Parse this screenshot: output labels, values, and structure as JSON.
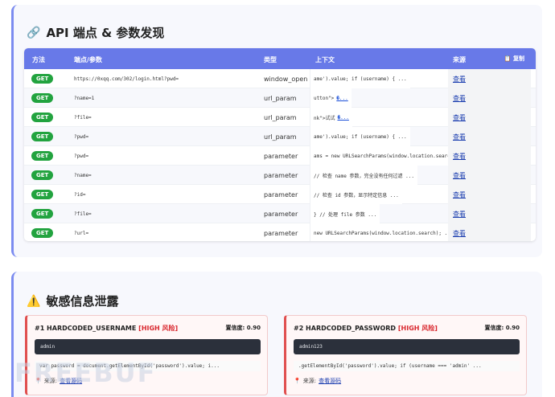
{
  "api_section": {
    "icon": "link-icon",
    "title": "API 端点 & 参数发现",
    "table": {
      "headers": {
        "method": "方法",
        "endpoint": "端点/参数",
        "type": "类型",
        "context": "上下文",
        "source": "来源"
      },
      "copy_label": "复制",
      "rows": [
        {
          "method": "GET",
          "endpoint": "https://0xqq.com/302/login.html?pwd=",
          "type": "window_open",
          "context": "ame').value; if (username) { ...",
          "context_link": "",
          "source": "查看"
        },
        {
          "method": "GET",
          "endpoint": "?name=1",
          "type": "url_param",
          "context": "utton\">",
          "context_link": "�...",
          "source": "查看"
        },
        {
          "method": "GET",
          "endpoint": "?file=",
          "type": "url_param",
          "context": "nk\">试试",
          "context_link": "�...",
          "source": "查看"
        },
        {
          "method": "GET",
          "endpoint": "?pwd=",
          "type": "url_param",
          "context": "ame').value; if (username) { ...",
          "context_link": "",
          "source": "查看"
        },
        {
          "method": "GET",
          "endpoint": "?pwd=",
          "type": "parameter",
          "context": "ams = new URLSearchParams(window.location.search); ...",
          "context_link": "",
          "source": "查看"
        },
        {
          "method": "GET",
          "endpoint": "?name=",
          "type": "parameter",
          "context": "// 检查 name 参数，完全没有任何过滤 ...",
          "context_link": "",
          "source": "查看"
        },
        {
          "method": "GET",
          "endpoint": "?id=",
          "type": "parameter",
          "context": "// 检查 id 参数，显示特定信息 ...",
          "context_link": "",
          "source": "查看"
        },
        {
          "method": "GET",
          "endpoint": "?file=",
          "type": "parameter",
          "context": "} // 处理 file 参数 ...",
          "context_link": "",
          "source": "查看"
        },
        {
          "method": "GET",
          "endpoint": "?url=",
          "type": "parameter",
          "context": "new URLSearchParams(window.location.search); ...",
          "context_link": "",
          "source": "查看"
        }
      ]
    }
  },
  "sensitive_section": {
    "icon": "warning-icon",
    "title": "敏感信息泄露",
    "items": [
      {
        "title": "#1 HARDCODED_USERNAME",
        "risk": "[HIGH 风险]",
        "confidence": "置信度: 0.90",
        "value": "admin",
        "code": "var password = document.getElementById('password').value; i...",
        "source_label": "来源:",
        "source_link": "查看源码"
      },
      {
        "title": "#2 HARDCODED_PASSWORD",
        "risk": "[HIGH 风险]",
        "confidence": "置信度: 0.90",
        "value": "admin123",
        "code": ".getElementById('password').value; if (username === 'admin' ...",
        "source_label": "来源:",
        "source_link": "查看源码"
      }
    ]
  },
  "watermark": "FREEBUF",
  "colors": {
    "header_bg": "#6879e8",
    "get_badge": "#22a33f",
    "risk": "#d9282f",
    "code_bg": "#2b303b"
  }
}
